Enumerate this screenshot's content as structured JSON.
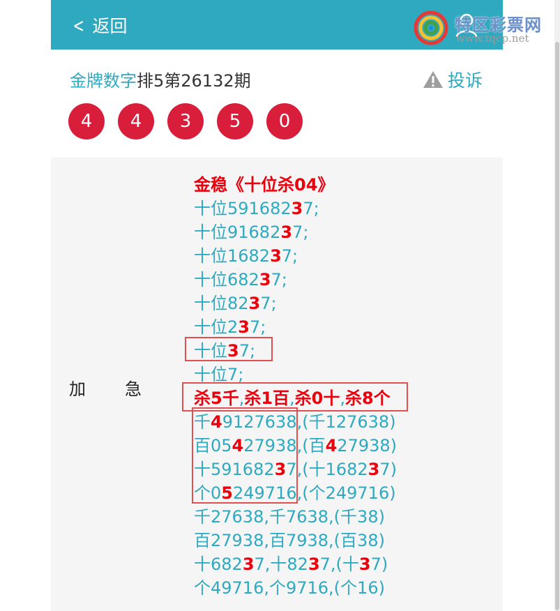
{
  "header": {
    "back_label": "返回",
    "logo_text": "特区彩票网",
    "logo_url": "www.tqcp.net"
  },
  "title": {
    "brand": "金牌数字",
    "rest": "排5第26132期",
    "complain_label": "投诉"
  },
  "balls": [
    "4",
    "4",
    "3",
    "5",
    "0"
  ],
  "panel": {
    "label_a": "加",
    "label_b": "急",
    "heading": "金稳《十位杀04》",
    "lines": [
      [
        {
          "t": "十位591682"
        },
        {
          "t": "3",
          "r": true
        },
        {
          "t": "7;"
        }
      ],
      [
        {
          "t": "十位91682"
        },
        {
          "t": "3",
          "r": true
        },
        {
          "t": "7;"
        }
      ],
      [
        {
          "t": "十位1682"
        },
        {
          "t": "3",
          "r": true
        },
        {
          "t": "7;"
        }
      ],
      [
        {
          "t": "十位682"
        },
        {
          "t": "3",
          "r": true
        },
        {
          "t": "7;"
        }
      ],
      [
        {
          "t": "十位82"
        },
        {
          "t": "3",
          "r": true
        },
        {
          "t": "7;"
        }
      ],
      [
        {
          "t": "十位2"
        },
        {
          "t": "3",
          "r": true
        },
        {
          "t": "7;"
        }
      ],
      [
        {
          "t": "十位"
        },
        {
          "t": "3",
          "r": true
        },
        {
          "t": "7;"
        }
      ],
      [
        {
          "t": "十位7;"
        }
      ],
      [
        {
          "t": "杀5千",
          "r": true
        },
        {
          "t": ","
        },
        {
          "t": "杀1百",
          "r": true
        },
        {
          "t": ","
        },
        {
          "t": "杀0十",
          "r": true
        },
        {
          "t": ","
        },
        {
          "t": "杀8个",
          "r": true
        }
      ],
      [
        {
          "t": "千"
        },
        {
          "t": "4",
          "r": true
        },
        {
          "t": "9127638,(千127638)"
        }
      ],
      [
        {
          "t": "百05"
        },
        {
          "t": "4",
          "r": true
        },
        {
          "t": "27938,(百"
        },
        {
          "t": "4",
          "r": true
        },
        {
          "t": "27938)"
        }
      ],
      [
        {
          "t": "十591682"
        },
        {
          "t": "3",
          "r": true
        },
        {
          "t": "7,(十1682"
        },
        {
          "t": "3",
          "r": true
        },
        {
          "t": "7)"
        }
      ],
      [
        {
          "t": "个0"
        },
        {
          "t": "5",
          "r": true
        },
        {
          "t": "249716,(个249716)"
        }
      ],
      [
        {
          "t": "千27638,千7638,(千38)"
        }
      ],
      [
        {
          "t": "百27938,百7938,(百38)"
        }
      ],
      [
        {
          "t": "十682"
        },
        {
          "t": "3",
          "r": true
        },
        {
          "t": "7,十82"
        },
        {
          "t": "3",
          "r": true
        },
        {
          "t": "7,(十"
        },
        {
          "t": "3",
          "r": true
        },
        {
          "t": "7)"
        }
      ],
      [
        {
          "t": "个49716,个9716,(个16)"
        }
      ]
    ]
  },
  "colors": {
    "header_bg": "#2fa9c0",
    "ball_bg": "#d81e3a",
    "highlight": "#e8000c",
    "text_teal": "#2fa9c0"
  }
}
